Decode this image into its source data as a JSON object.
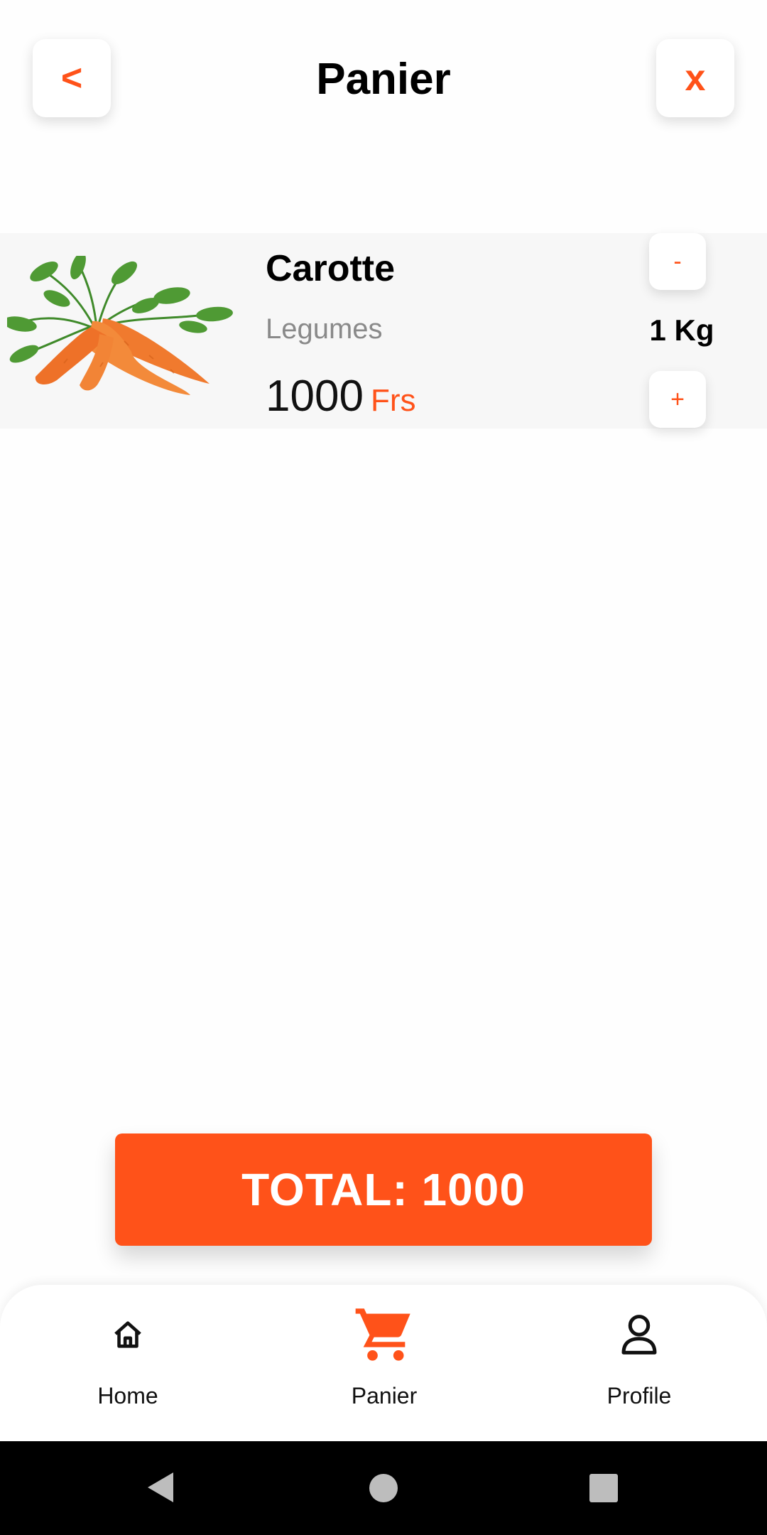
{
  "header": {
    "back_label": "<",
    "title": "Panier",
    "close_label": "x"
  },
  "cart": {
    "items": [
      {
        "name": "Carotte",
        "category": "Legumes",
        "price": "1000",
        "currency": "Frs",
        "quantity": "1 Kg",
        "decrement_label": "-",
        "increment_label": "+",
        "image_icon": "carrot-image"
      }
    ]
  },
  "total": {
    "label": "TOTAL: 1000"
  },
  "nav": {
    "items": [
      {
        "label": "Home",
        "icon": "home-icon",
        "active": false
      },
      {
        "label": "Panier",
        "icon": "cart-icon",
        "active": true
      },
      {
        "label": "Profile",
        "icon": "user-icon",
        "active": false
      }
    ]
  },
  "colors": {
    "accent": "#ff5219",
    "item_background": "#f7f7f7",
    "category_text": "#8a8a8a",
    "system_bar": "#000000"
  }
}
